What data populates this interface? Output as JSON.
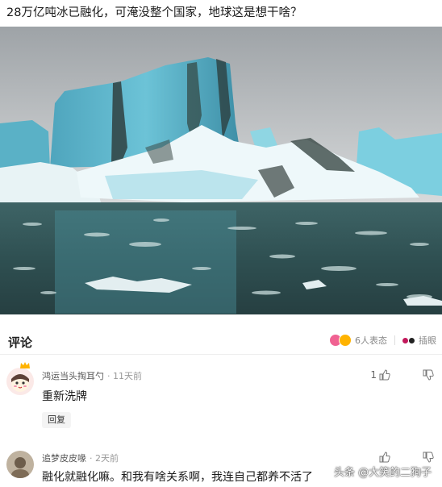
{
  "post": {
    "headline": "28万亿吨冰已融化，可淹没整个国家，地球这是想干啥？",
    "image_icon": "glacier-photo"
  },
  "comments_header": {
    "title": "评论",
    "reaction_text": "6人表态",
    "insert_text": "插眼",
    "reaction_icons": [
      "emoji-heart-icon",
      "emoji-face-icon"
    ]
  },
  "comments": [
    {
      "author": "鸿运当头掏耳勺",
      "time": "· 11天前",
      "text": "重新洗牌",
      "reply_label": "回复",
      "likes": "1"
    },
    {
      "author": "追梦皮皮喙",
      "time": "· 2天前",
      "text": "融化就融化嘛。和我有啥关系啊，我连自己都养不活了",
      "likes": ""
    }
  ],
  "watermark": "头条 @大笑的二狗子",
  "colors": {
    "accent_pink": "#f06292",
    "accent_gold": "#ffb300",
    "muted_text": "#999999",
    "ice_blue": "#5fb8cf"
  }
}
